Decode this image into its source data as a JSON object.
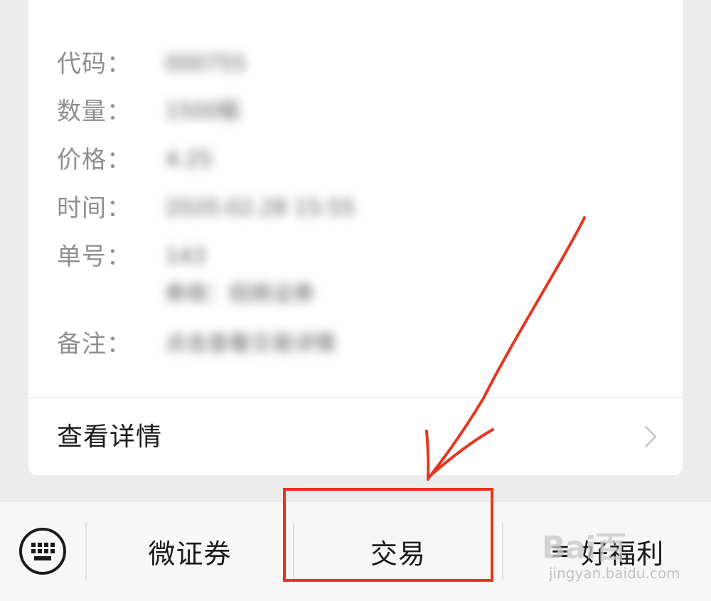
{
  "card": {
    "fields": [
      {
        "label": "代码：",
        "value": "000755"
      },
      {
        "label": "数量：",
        "value": "1500股"
      },
      {
        "label": "价格：",
        "value": "4.25"
      },
      {
        "label": "时间：",
        "value": "2020.02.28 15:55"
      },
      {
        "label": "单号：",
        "value": "143",
        "value2": "券商：招商证券"
      },
      {
        "label": "备注：",
        "value": "点击查看交易详情"
      }
    ],
    "detail_link": "查看详情"
  },
  "menu": {
    "keyboard_icon": "keyboard-icon",
    "items": [
      {
        "label": "微证券"
      },
      {
        "label": "交易"
      },
      {
        "label": "好福利",
        "icon": "≡"
      }
    ]
  },
  "annotation": {
    "color": "#e8341f"
  },
  "watermark": {
    "brand": "Bai百",
    "site": "jingyan.baidu.com"
  }
}
